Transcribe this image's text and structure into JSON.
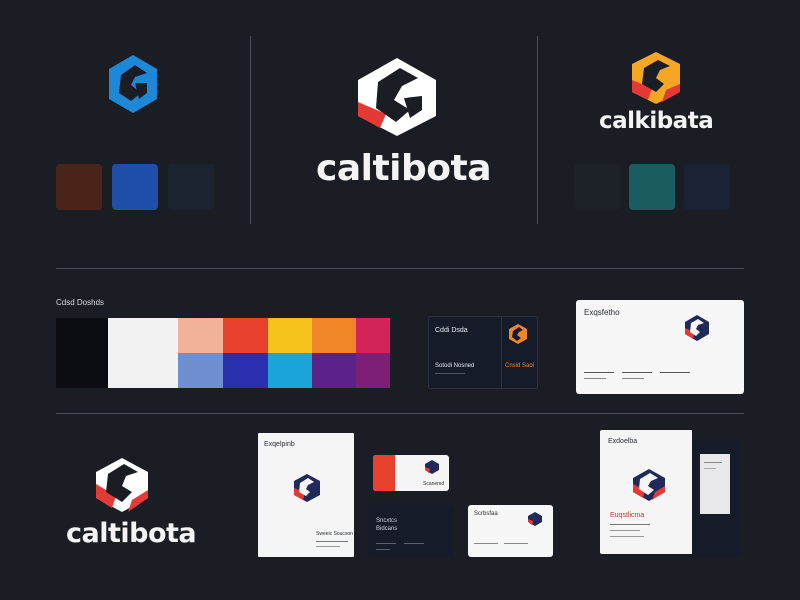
{
  "brand": {
    "wordmark_large": "caltibota",
    "wordmark_right": "calkibata",
    "wordmark_bottom": "caltibota"
  },
  "swatches_left": [
    "#4a2418",
    "#1f4fa8",
    "#1c2330"
  ],
  "swatches_right": [
    "#1d2229",
    "#1b5c60",
    "#1a2236"
  ],
  "palette": {
    "label": "Cdsd Doshds",
    "top_row": [
      "#0b0d12",
      "#f2f2f2",
      "#f2b29a",
      "#e8412f",
      "#f6c21c",
      "#f0862a",
      "#d3245a"
    ],
    "bottom_row": [
      "#0b0d12",
      "#f2f2f2",
      "#6f8fd0",
      "#2a2fae",
      "#1aa4d8",
      "#5b2289",
      "#7d1f77"
    ]
  },
  "dark_card": {
    "title": "Cddi Dsda",
    "subtitle": "Sotodi Nosned",
    "right_text": "Cnsid Saoi"
  },
  "letterhead_wide": {
    "title": "Exqsfetho"
  },
  "brochure": {
    "title": "Exqelpinb",
    "footer": "Sweeic Soucson"
  },
  "small_card_red": {
    "text": "Scanemd"
  },
  "small_card_dark": {
    "text": "Sncxtcs Bidcans"
  },
  "small_card_white": {
    "text": "Scrbsfaa"
  },
  "book": {
    "title": "Exdoelba",
    "subtitle": "Euqstlicma"
  },
  "colors": {
    "background": "#1a1d23",
    "divider": "#4a4e57",
    "logo_blue": "#1e88d8",
    "logo_red": "#e53935",
    "logo_orange": "#f5a623"
  }
}
